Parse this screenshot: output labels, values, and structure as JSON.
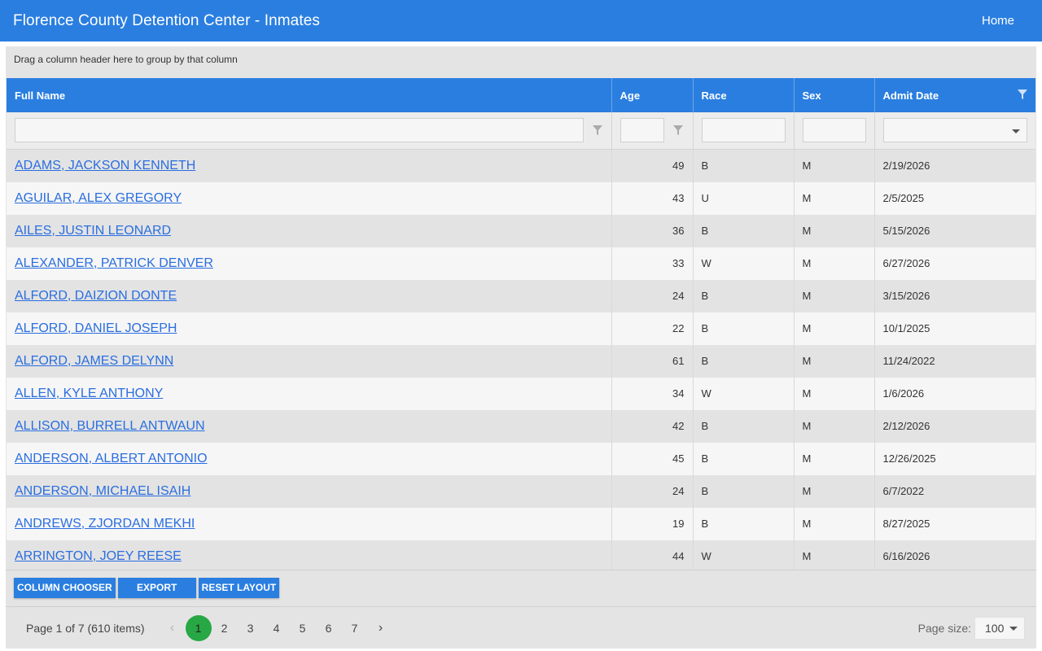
{
  "app": {
    "title": "Florence County Detention Center - Inmates",
    "home_link": "Home"
  },
  "colors": {
    "header_blue": "#2a7ee0",
    "active_page": "#28a745",
    "link": "#2a6ee0"
  },
  "grid": {
    "group_panel_text": "Drag a column header here to group by that column",
    "columns": [
      {
        "label": "Full Name"
      },
      {
        "label": "Age"
      },
      {
        "label": "Race"
      },
      {
        "label": "Sex"
      },
      {
        "label": "Admit Date"
      }
    ],
    "rows": [
      {
        "name": "ADAMS, JACKSON KENNETH",
        "age": "49",
        "race": "B",
        "sex": "M",
        "admit": "2/19/2026"
      },
      {
        "name": "AGUILAR, ALEX GREGORY",
        "age": "43",
        "race": "U",
        "sex": "M",
        "admit": "2/5/2025"
      },
      {
        "name": "AILES, JUSTIN LEONARD",
        "age": "36",
        "race": "B",
        "sex": "M",
        "admit": "5/15/2026"
      },
      {
        "name": "ALEXANDER, PATRICK DENVER",
        "age": "33",
        "race": "W",
        "sex": "M",
        "admit": "6/27/2026"
      },
      {
        "name": "ALFORD, DAIZION DONTE",
        "age": "24",
        "race": "B",
        "sex": "M",
        "admit": "3/15/2026"
      },
      {
        "name": "ALFORD, DANIEL JOSEPH",
        "age": "22",
        "race": "B",
        "sex": "M",
        "admit": "10/1/2025"
      },
      {
        "name": "ALFORD, JAMES DELYNN",
        "age": "61",
        "race": "B",
        "sex": "M",
        "admit": "11/24/2022"
      },
      {
        "name": "ALLEN, KYLE ANTHONY",
        "age": "34",
        "race": "W",
        "sex": "M",
        "admit": "1/6/2026"
      },
      {
        "name": "ALLISON, BURRELL ANTWAUN",
        "age": "42",
        "race": "B",
        "sex": "M",
        "admit": "2/12/2026"
      },
      {
        "name": "ANDERSON, ALBERT ANTONIO",
        "age": "45",
        "race": "B",
        "sex": "M",
        "admit": "12/26/2025"
      },
      {
        "name": "ANDERSON, MICHAEL ISAIH",
        "age": "24",
        "race": "B",
        "sex": "M",
        "admit": "6/7/2022"
      },
      {
        "name": "ANDREWS, ZJORDAN MEKHI",
        "age": "19",
        "race": "B",
        "sex": "M",
        "admit": "8/27/2025"
      },
      {
        "name": "ARRINGTON, JOEY REESE",
        "age": "44",
        "race": "W",
        "sex": "M",
        "admit": "6/16/2026"
      }
    ]
  },
  "toolbar": {
    "column_chooser": "COLUMN CHOOSER",
    "export": "EXPORT",
    "reset_layout": "RESET LAYOUT"
  },
  "pager": {
    "info": "Page 1 of 7 (610 items)",
    "pages": [
      "1",
      "2",
      "3",
      "4",
      "5",
      "6",
      "7"
    ],
    "active_page": "1",
    "prev_icon": "‹",
    "next_icon": "›",
    "page_size_label": "Page size:",
    "page_size_value": "100"
  }
}
